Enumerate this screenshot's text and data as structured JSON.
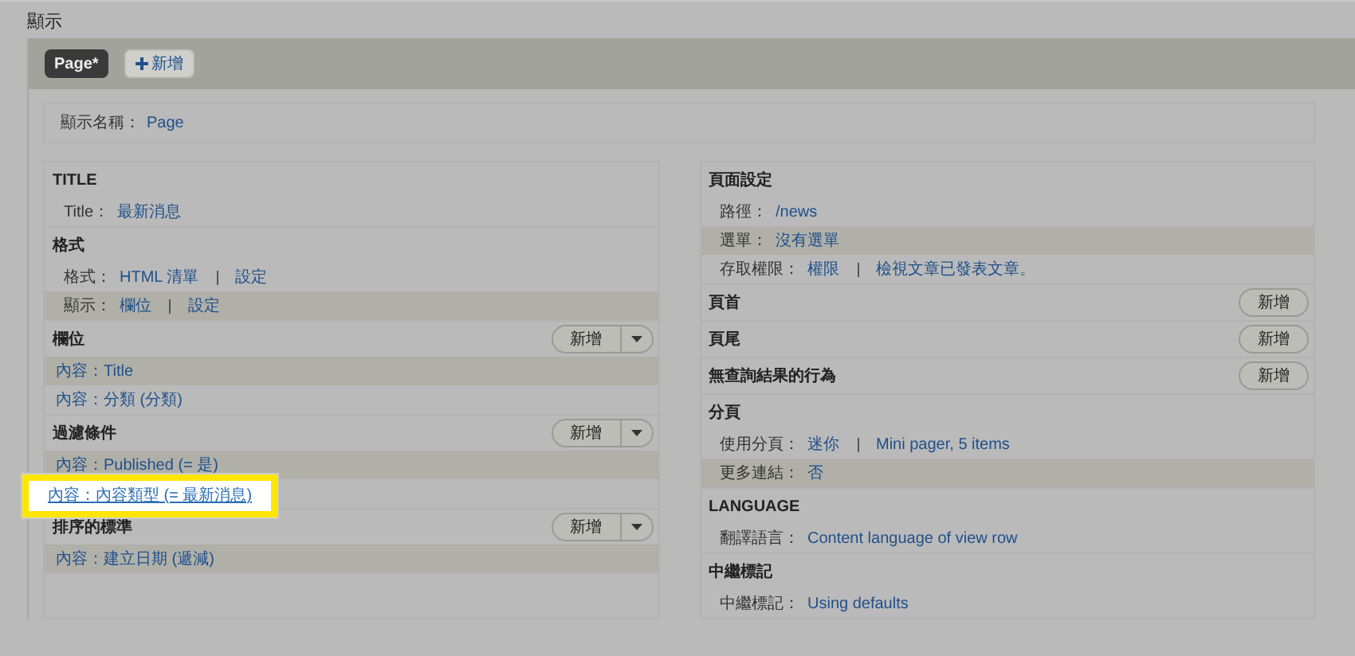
{
  "page_title": "顯示",
  "tabs": [
    {
      "label": "Page*",
      "selected": true
    },
    {
      "label": "新增",
      "kind": "add",
      "selected": false
    }
  ],
  "display_name": {
    "label": "顯示名稱：",
    "value": "Page"
  },
  "columns": [
    [
      {
        "title": "TITLE",
        "rows": [
          {
            "label": "Title：",
            "links": [
              "最新消息"
            ],
            "striped": false,
            "highlighted": false
          }
        ]
      },
      {
        "title": "格式",
        "rows": [
          {
            "label": "格式：",
            "links": [
              "HTML 清單",
              "設定"
            ],
            "striped": false,
            "highlighted": false
          },
          {
            "label": "顯示：",
            "links": [
              "欄位",
              "設定"
            ],
            "striped": true,
            "highlighted": false
          }
        ]
      },
      {
        "title": "欄位",
        "button": {
          "label": "新增",
          "kind": "split"
        },
        "rows": [
          {
            "links": [
              "內容：Title"
            ],
            "striped": true,
            "highlighted": false
          },
          {
            "links": [
              "內容：分類 (分類)"
            ],
            "striped": false,
            "highlighted": false
          }
        ]
      },
      {
        "title": "過濾條件",
        "button": {
          "label": "新增",
          "kind": "split"
        },
        "rows": [
          {
            "links": [
              "內容：Published (= 是)"
            ],
            "striped": true,
            "highlighted": false
          },
          {
            "links": [
              "內容：內容類型 (= 最新消息)"
            ],
            "striped": false,
            "highlighted": true
          }
        ]
      },
      {
        "title": "排序的標準",
        "button": {
          "label": "新增",
          "kind": "split"
        },
        "rows": [
          {
            "links": [
              "內容：建立日期 (遞減)"
            ],
            "striped": true,
            "highlighted": false
          }
        ]
      }
    ],
    [
      {
        "title": "頁面設定",
        "rows": [
          {
            "label": "路徑：",
            "links": [
              "/news"
            ],
            "striped": false,
            "highlighted": false
          },
          {
            "label": "選單：",
            "links": [
              "沒有選單"
            ],
            "striped": true,
            "highlighted": false
          },
          {
            "label": "存取權限：",
            "links": [
              "權限",
              "檢視文章已發表文章。"
            ],
            "striped": false,
            "highlighted": false
          }
        ]
      },
      {
        "title": "頁首",
        "button": {
          "label": "新增",
          "kind": "plain"
        }
      },
      {
        "title": "頁尾",
        "button": {
          "label": "新增",
          "kind": "plain"
        }
      },
      {
        "title": "無查詢結果的行為",
        "button": {
          "label": "新增",
          "kind": "plain"
        }
      },
      {
        "title": "分頁",
        "rows": [
          {
            "label": "使用分頁：",
            "links": [
              "迷你",
              "Mini pager, 5 items"
            ],
            "striped": false,
            "highlighted": false
          },
          {
            "label": "更多連結：",
            "links": [
              "否"
            ],
            "striped": true,
            "highlighted": false
          }
        ]
      },
      {
        "title": "LANGUAGE",
        "rows": [
          {
            "label": "翻譯語言：",
            "links": [
              "Content language of view row"
            ],
            "striped": false,
            "highlighted": false
          }
        ]
      },
      {
        "title": "中繼標記",
        "rows": [
          {
            "label": "中繼標記：",
            "links": [
              "Using defaults"
            ],
            "striped": false,
            "highlighted": false
          }
        ]
      }
    ]
  ]
}
